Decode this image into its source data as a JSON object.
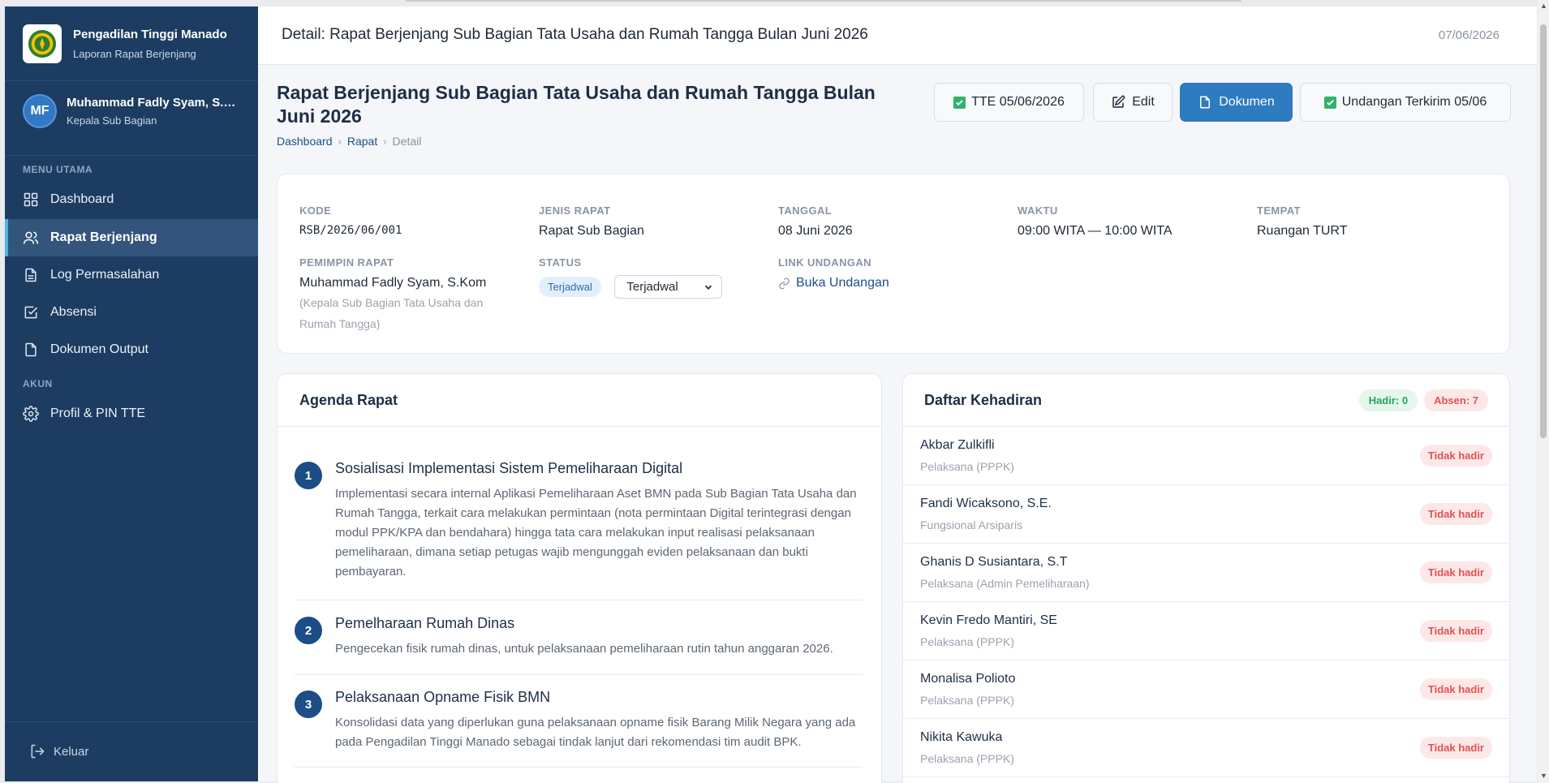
{
  "sidebar": {
    "org_name": "Pengadilan Tinggi Manado",
    "app_name": "Laporan Rapat Berjenjang",
    "user_initials": "MF",
    "user_name": "Muhammad Fadly Syam, S.Kom",
    "user_role": "Kepala Sub Bagian",
    "section_main": "MENU UTAMA",
    "section_account": "AKUN",
    "items": [
      {
        "label": "Dashboard",
        "icon": "grid-icon"
      },
      {
        "label": "Rapat Berjenjang",
        "icon": "users-icon",
        "active": true
      },
      {
        "label": "Log Permasalahan",
        "icon": "document-icon"
      },
      {
        "label": "Absensi",
        "icon": "checkbox-icon"
      },
      {
        "label": "Dokumen Output",
        "icon": "file-icon"
      }
    ],
    "account_items": [
      {
        "label": "Profil & PIN TTE",
        "icon": "gear-icon"
      }
    ],
    "logout_label": "Keluar"
  },
  "header": {
    "title": "Detail: Rapat Berjenjang Sub Bagian Tata Usaha dan Rumah Tangga Bulan Juni 2026",
    "date": "07/06/2026"
  },
  "page": {
    "title": "Rapat Berjenjang Sub Bagian Tata Usaha dan Rumah Tangga Bulan Juni 2026",
    "breadcrumb": [
      "Dashboard",
      "Rapat",
      "Detail"
    ],
    "buttons": {
      "tte": "TTE 05/06/2026",
      "edit": "Edit",
      "dokumen": "Dokumen",
      "undangan": "Undangan Terkirim 05/06"
    }
  },
  "info": {
    "kode_label": "KODE",
    "kode": "RSB/2026/06/001",
    "jenis_label": "JENIS RAPAT",
    "jenis": "Rapat Sub Bagian",
    "tanggal_label": "TANGGAL",
    "tanggal": "08 Juni 2026",
    "waktu_label": "WAKTU",
    "waktu": "09:00 WITA — 10:00 WITA",
    "tempat_label": "TEMPAT",
    "tempat": "Ruangan TURT",
    "pemimpin_label": "PEMIMPIN RAPAT",
    "pemimpin": "Muhammad Fadly Syam, S.Kom",
    "pemimpin_jabatan": "(Kepala Sub Bagian Tata Usaha dan Rumah Tangga)",
    "status_label": "STATUS",
    "status_badge": "Terjadwal",
    "status_select": "Terjadwal",
    "link_label": "LINK UNDANGAN",
    "link_text": "Buka Undangan"
  },
  "agenda": {
    "title": "Agenda Rapat",
    "items": [
      {
        "num": "1",
        "title": "Sosialisasi Implementasi Sistem Pemeliharaan Digital",
        "desc": "Implementasi secara internal Aplikasi Pemeliharaan Aset BMN pada Sub Bagian Tata Usaha dan Rumah Tangga, terkait cara melakukan permintaan (nota permintaan Digital terintegrasi dengan modul PPK/KPA dan bendahara) hingga tata cara melakukan input realisasi pelaksanaan pemeliharaan, dimana setiap petugas wajib mengunggah eviden pelaksanaan dan bukti pembayaran."
      },
      {
        "num": "2",
        "title": "Pemelharaan Rumah Dinas",
        "desc": "Pengecekan fisik rumah dinas, untuk pelaksanaan pemeliharaan rutin tahun anggaran 2026."
      },
      {
        "num": "3",
        "title": "Pelaksanaan Opname Fisik BMN",
        "desc": "Konsolidasi data yang diperlukan guna pelaksanaan opname fisik Barang Milik Negara yang ada pada Pengadilan Tinggi Manado sebagai tindak lanjut dari rekomendasi tim audit BPK."
      }
    ]
  },
  "attendance": {
    "title": "Daftar Kehadiran",
    "hadir": "Hadir: 0",
    "absen": "Absen: 7",
    "rows": [
      {
        "name": "Akbar Zulkifli",
        "role": "Pelaksana (PPPK)",
        "status": "Tidak hadir"
      },
      {
        "name": "Fandi Wicaksono, S.E.",
        "role": "Fungsional Arsiparis",
        "status": "Tidak hadir"
      },
      {
        "name": "Ghanis D Susiantara, S.T",
        "role": "Pelaksana (Admin Pemeliharaan)",
        "status": "Tidak hadir"
      },
      {
        "name": "Kevin Fredo Mantiri, SE",
        "role": "Pelaksana (PPPK)",
        "status": "Tidak hadir"
      },
      {
        "name": "Monalisa Polioto",
        "role": "Pelaksana (PPPK)",
        "status": "Tidak hadir"
      },
      {
        "name": "Nikita Kawuka",
        "role": "Pelaksana (PPPK)",
        "status": "Tidak hadir"
      }
    ]
  },
  "colors": {
    "sidebar_bg": "#1c3d61",
    "primary": "#2f7bbf",
    "accent_active": "#4fb0ef",
    "success": "#31b26a",
    "danger": "#e05252"
  }
}
